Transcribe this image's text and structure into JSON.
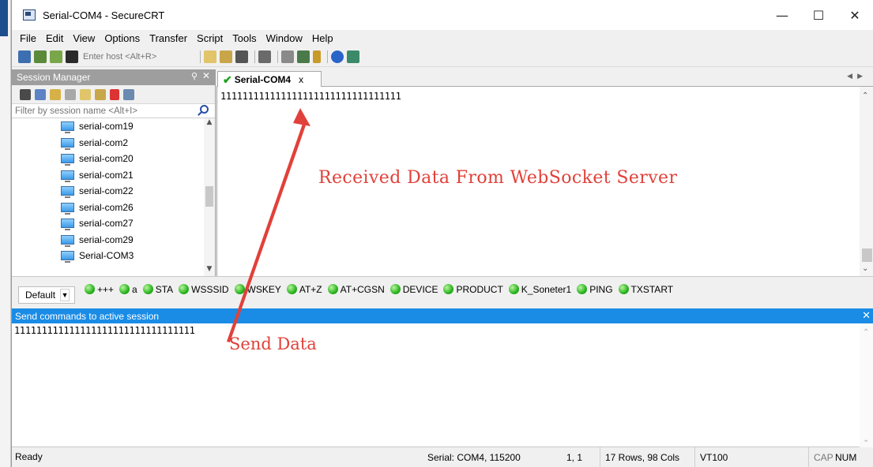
{
  "window": {
    "title": "Serial-COM4 - SecureCRT"
  },
  "menu": [
    {
      "label": "File"
    },
    {
      "label": "Edit"
    },
    {
      "label": "View"
    },
    {
      "label": "Options"
    },
    {
      "label": "Transfer"
    },
    {
      "label": "Script"
    },
    {
      "label": "Tools"
    },
    {
      "label": "Window"
    },
    {
      "label": "Help"
    }
  ],
  "toolbar": {
    "host_placeholder": "Enter host <Alt+R>"
  },
  "session_manager": {
    "title": "Session Manager",
    "filter_placeholder": "Filter by session name <Alt+I>",
    "items": [
      {
        "label": "serial-com19"
      },
      {
        "label": "serial-com2"
      },
      {
        "label": "serial-com20"
      },
      {
        "label": "serial-com21"
      },
      {
        "label": "serial-com22"
      },
      {
        "label": "serial-com26"
      },
      {
        "label": "serial-com27"
      },
      {
        "label": "serial-com29"
      },
      {
        "label": "Serial-COM3"
      }
    ]
  },
  "tab": {
    "label": "Serial-COM4",
    "close": "x"
  },
  "terminal": {
    "text": "111111111111111111111111111111111"
  },
  "annotations": {
    "received": "Received Data From WebSocket Server",
    "send": "Send Data",
    "color": "#e0413a"
  },
  "button_bar": {
    "group": "Default",
    "buttons": [
      {
        "label": "+++"
      },
      {
        "label": "a"
      },
      {
        "label": "STA"
      },
      {
        "label": "WSSSID"
      },
      {
        "label": "WSKEY"
      },
      {
        "label": "AT+Z"
      },
      {
        "label": "AT+CGSN"
      },
      {
        "label": "DEVICE"
      },
      {
        "label": "PRODUCT"
      },
      {
        "label": "K_Soneter1"
      },
      {
        "label": "PING"
      },
      {
        "label": "TXSTART"
      }
    ]
  },
  "send_panel": {
    "title": "Send commands to active session",
    "text": "111111111111111111111111111111111"
  },
  "status": {
    "ready": "Ready",
    "serial": "Serial: COM4, 115200",
    "cursor": "1,  1",
    "size": "17 Rows, 98 Cols",
    "emulation": "VT100",
    "caps": "CAP",
    "num": "NUM"
  },
  "colors": {
    "accent": "#1a8ce6",
    "tab_check": "#1aa31a",
    "annotation": "#e0413a",
    "button_dot": "#29b41d"
  }
}
